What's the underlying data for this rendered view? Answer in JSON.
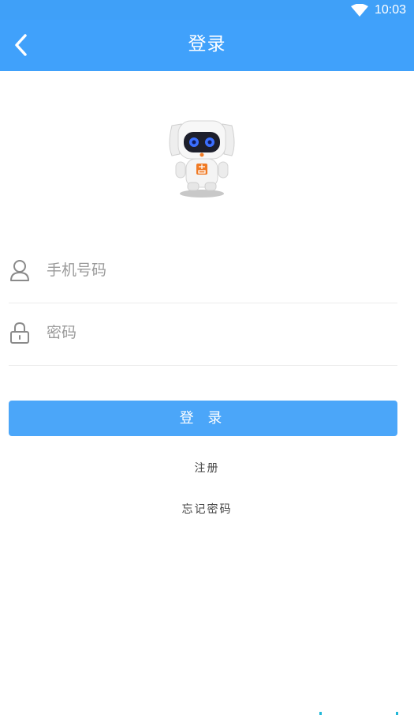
{
  "status_bar": {
    "time": "10:03",
    "wifi_icon": "wifi-icon"
  },
  "app_bar": {
    "title": "登录",
    "back_icon": "chevron-left-icon"
  },
  "form": {
    "phone_placeholder": "手机号码",
    "phone_icon": "user-icon",
    "password_placeholder": "密码",
    "password_icon": "lock-icon",
    "login_label": "登 录"
  },
  "links": {
    "register": "注册",
    "forgot_password": "忘记密码"
  },
  "colors": {
    "primary": "#40a1fb",
    "button": "#4ba6f9",
    "divider": "#ececec",
    "mascot_badge": "#f07a24"
  }
}
